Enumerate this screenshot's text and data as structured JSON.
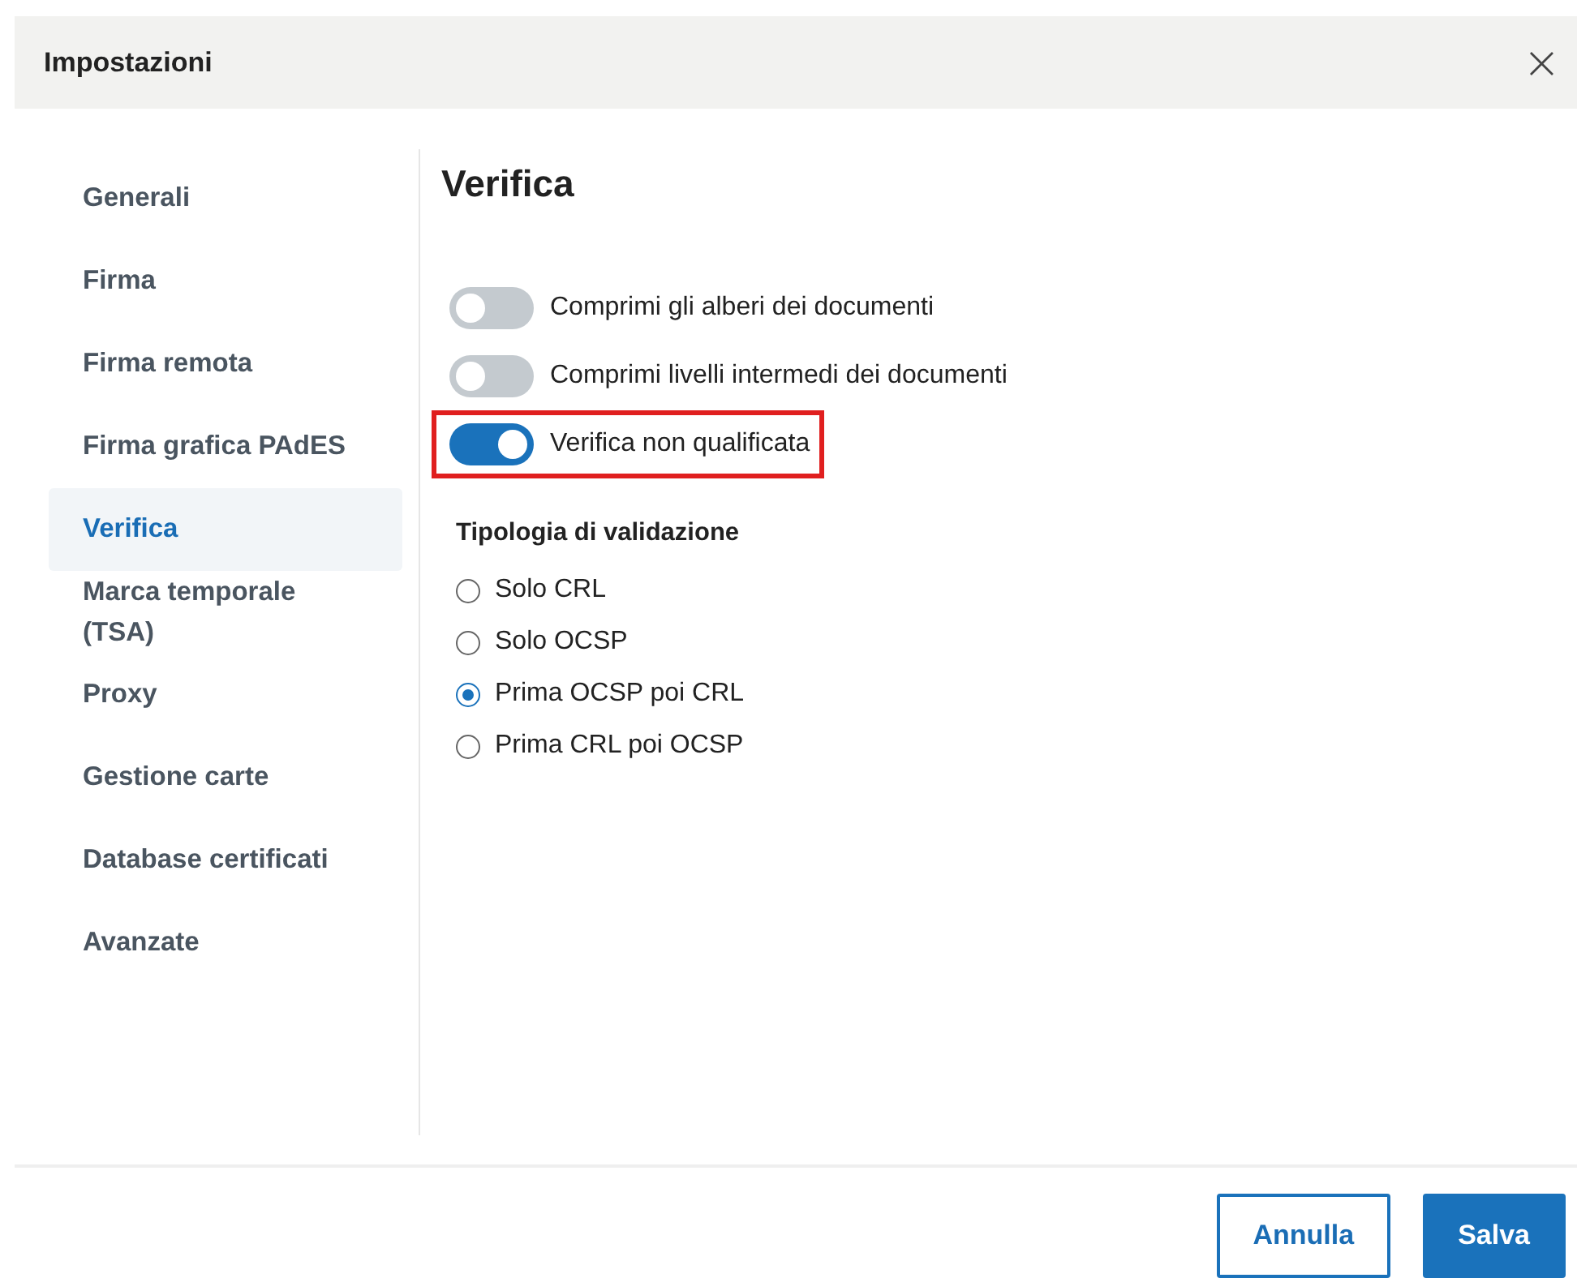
{
  "dialog": {
    "title": "Impostazioni",
    "close": "×"
  },
  "sidebar": {
    "items": [
      {
        "label": "Generali",
        "selected": false
      },
      {
        "label": "Firma",
        "selected": false
      },
      {
        "label": "Firma remota",
        "selected": false
      },
      {
        "label": "Firma grafica PAdES",
        "selected": false
      },
      {
        "label": "Verifica",
        "selected": true
      },
      {
        "label": "Marca temporale (TSA)",
        "selected": false
      },
      {
        "label": "Proxy",
        "selected": false
      },
      {
        "label": "Gestione carte",
        "selected": false
      },
      {
        "label": "Database certificati",
        "selected": false
      },
      {
        "label": "Avanzate",
        "selected": false
      }
    ]
  },
  "content": {
    "title": "Verifica",
    "toggles": [
      {
        "label": "Comprimi gli alberi dei documenti",
        "on": false,
        "highlighted": false
      },
      {
        "label": "Comprimi livelli intermedi dei documenti",
        "on": false,
        "highlighted": false
      },
      {
        "label": "Verifica non qualificata",
        "on": true,
        "highlighted": true
      }
    ],
    "validation": {
      "title": "Tipologia di validazione",
      "options": [
        {
          "label": "Solo CRL",
          "selected": false
        },
        {
          "label": "Solo OCSP",
          "selected": false
        },
        {
          "label": "Prima OCSP poi CRL",
          "selected": true
        },
        {
          "label": "Prima CRL poi OCSP",
          "selected": false
        }
      ]
    }
  },
  "buttons": [
    {
      "label": "Annulla",
      "kind": "secondary"
    },
    {
      "label": "Salva",
      "kind": "primary"
    }
  ]
}
